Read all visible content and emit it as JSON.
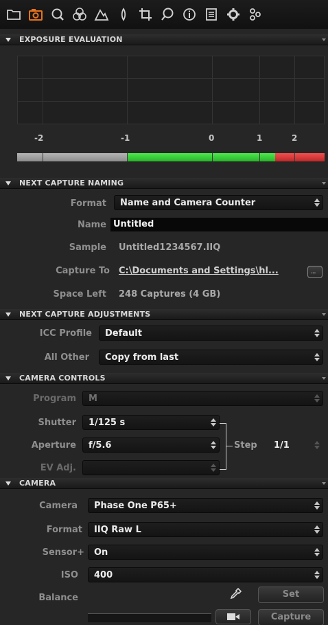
{
  "toolbar": {
    "icons": [
      "folder-icon",
      "camera-icon",
      "search-icon",
      "color-icon",
      "exposure-icon",
      "focus-icon",
      "crop-icon",
      "lens-icon",
      "info-icon",
      "output-icon",
      "settings-icon",
      "adjustments-icon"
    ],
    "active_color": "#e8731c"
  },
  "exposure": {
    "title": "EXPOSURE EVALUATION",
    "scale": [
      "-2",
      "-1",
      "0",
      "1",
      "2"
    ]
  },
  "naming": {
    "title": "NEXT CAPTURE NAMING",
    "format_label": "Format",
    "format_value": "Name and Camera Counter",
    "name_label": "Name",
    "name_value": "Untitled",
    "sample_label": "Sample",
    "sample_value": "Untitled1234567.IIQ",
    "capture_to_label": "Capture To",
    "capture_to_value": "C:\\Documents and Settings\\hl...",
    "browse_label": "...",
    "space_label": "Space Left",
    "space_value": "248 Captures (4 GB)"
  },
  "adjustments": {
    "title": "NEXT CAPTURE ADJUSTMENTS",
    "icc_label": "ICC Profile",
    "icc_value": "Default",
    "other_label": "All Other",
    "other_value": "Copy from last"
  },
  "camera_controls": {
    "title": "CAMERA CONTROLS",
    "program_label": "Program",
    "program_value": "M",
    "shutter_label": "Shutter",
    "shutter_value": "1/125 s",
    "aperture_label": "Aperture",
    "aperture_value": "f/5.6",
    "ev_label": "EV Adj.",
    "ev_value": "",
    "step_label": "Step",
    "step_value": "1/1"
  },
  "camera": {
    "title": "CAMERA",
    "camera_label": "Camera",
    "camera_value": "Phase One P65+",
    "format_label": "Format",
    "format_value": "IIQ Raw L",
    "sensor_label": "Sensor+",
    "sensor_value": "On",
    "iso_label": "ISO",
    "iso_value": "400",
    "balance_label": "Balance",
    "set_label": "Set",
    "capture_label": "Capture"
  }
}
